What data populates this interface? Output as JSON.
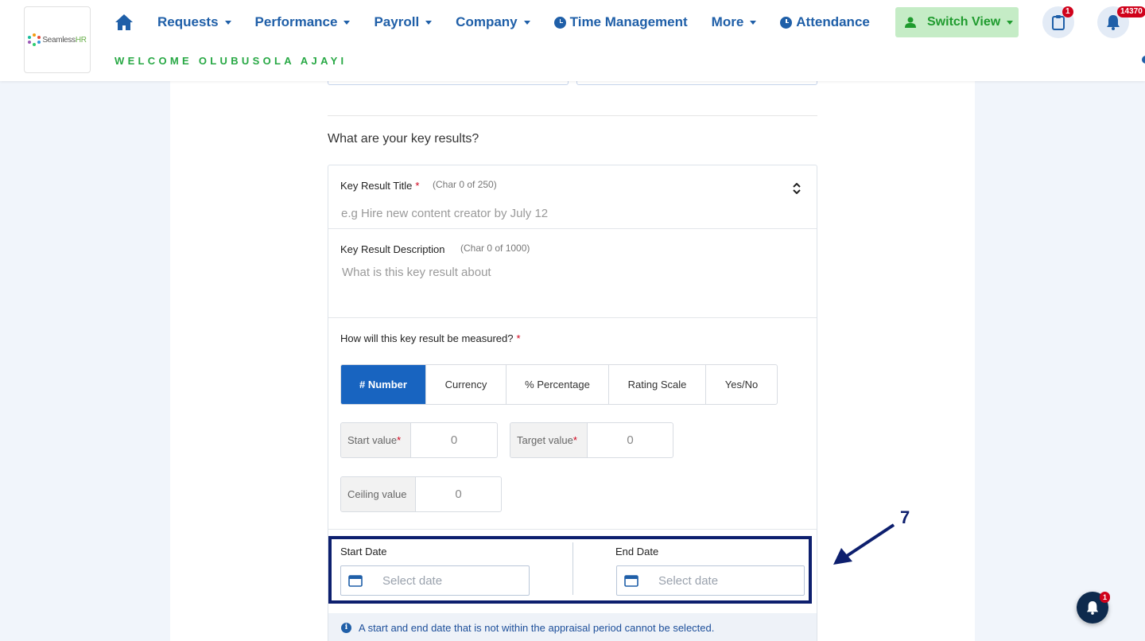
{
  "brand": {
    "logo_text_a": "Seamless",
    "logo_text_b": "HR"
  },
  "nav": {
    "items": [
      {
        "label": "Requests",
        "dropdown": true
      },
      {
        "label": "Performance",
        "dropdown": true
      },
      {
        "label": "Payroll",
        "dropdown": true
      },
      {
        "label": "Company",
        "dropdown": true
      },
      {
        "label": "Time Management",
        "icon": "clock-icon"
      },
      {
        "label": "More",
        "dropdown": true
      },
      {
        "label": "Attendance",
        "icon": "clock-icon"
      }
    ]
  },
  "welcome": "WELCOME OLUBUSOLA AJAYI",
  "switch_view": {
    "label": "Switch View"
  },
  "clipboard_badge": "1",
  "notifications_badge": "14370",
  "question": "What are your key results?",
  "key_result": {
    "title_label": "Key Result Title",
    "title_required": "*",
    "title_char": "(Char 0 of 250)",
    "title_placeholder": "e.g Hire new content creator by July 12",
    "desc_label": "Key Result Description",
    "desc_char": "(Char 0 of 1000)",
    "desc_placeholder": "What is this key result about",
    "measure_label": "How will this key result be measured?",
    "measure_required": "*",
    "measure_options": [
      {
        "label": "# Number",
        "active": true
      },
      {
        "label": "Currency"
      },
      {
        "label": "% Percentage"
      },
      {
        "label": "Rating Scale"
      },
      {
        "label": "Yes/No"
      }
    ],
    "start_value_label": "Start value",
    "start_value": "0",
    "target_value_label": "Target value",
    "target_value": "0",
    "ceiling_value_label": "Ceiling value",
    "ceiling_value": "0",
    "start_date_label": "Start Date",
    "end_date_label": "End Date",
    "date_placeholder": "Select date",
    "info_text": "A start and end date that is not within the appraisal period cannot be selected."
  },
  "annotation": {
    "step_number": "7"
  },
  "chat_badge": "1",
  "colors": {
    "primary": "#1f5fa8",
    "active": "#1864c0",
    "welcome": "#27a844",
    "annotation": "#0d1f6e",
    "required": "#d0021b"
  }
}
